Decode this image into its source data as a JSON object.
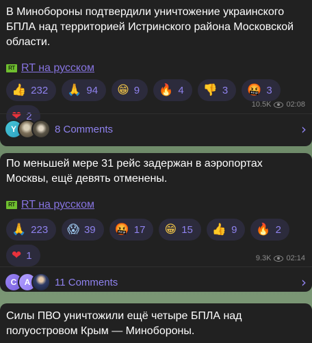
{
  "messages": [
    {
      "text": "В Минобороны подтвердили уничтожение украинского БПЛА над территорией Истринского района Московской области.",
      "source": "RT на русском",
      "reactions": [
        {
          "icon": "thumbs-up-icon",
          "glyph": "👍",
          "count": "232"
        },
        {
          "icon": "folded-hands-icon",
          "glyph": "🙏",
          "count": "94"
        },
        {
          "icon": "grinning-face-icon",
          "glyph": "😁",
          "count": "9"
        },
        {
          "icon": "fire-icon",
          "glyph": "🔥",
          "count": "4"
        },
        {
          "icon": "thumbs-down-icon",
          "glyph": "👎",
          "count": "3"
        },
        {
          "icon": "swearing-face-icon",
          "glyph": "🤬",
          "count": "3"
        },
        {
          "icon": "heart-icon",
          "glyph": "❤",
          "count": "2"
        }
      ],
      "views": "10.5K",
      "time": "02:08",
      "comments": "8 Comments",
      "avatar_letter": "Y"
    },
    {
      "text": "По меньшей мере 31 рейс задержан в аэропортах Москвы, ещё девять отменены.",
      "source": "RT на русском",
      "reactions": [
        {
          "icon": "folded-hands-icon",
          "glyph": "🙏",
          "count": "223"
        },
        {
          "icon": "screaming-face-icon",
          "glyph": "😱",
          "count": "39"
        },
        {
          "icon": "swearing-face-icon",
          "glyph": "🤬",
          "count": "17"
        },
        {
          "icon": "grinning-face-icon",
          "glyph": "😁",
          "count": "15"
        },
        {
          "icon": "thumbs-up-icon",
          "glyph": "👍",
          "count": "9"
        },
        {
          "icon": "fire-icon",
          "glyph": "🔥",
          "count": "2"
        },
        {
          "icon": "heart-icon",
          "glyph": "❤",
          "count": "1"
        }
      ],
      "views": "9.3K",
      "time": "02:14",
      "comments": "11 Comments",
      "avatar_letters": [
        "C",
        "A"
      ]
    },
    {
      "text": "Силы ПВО уничтожили ещё четыре БПЛА над полуостровом Крым — Минобороны."
    }
  ],
  "rt_logo_text": "RT",
  "colors": {
    "bubble": "#212121",
    "accent": "#8f82ee",
    "link": "#8774e1",
    "meta": "#8b8b8b",
    "reaction_bg": "#2c2b3c"
  }
}
